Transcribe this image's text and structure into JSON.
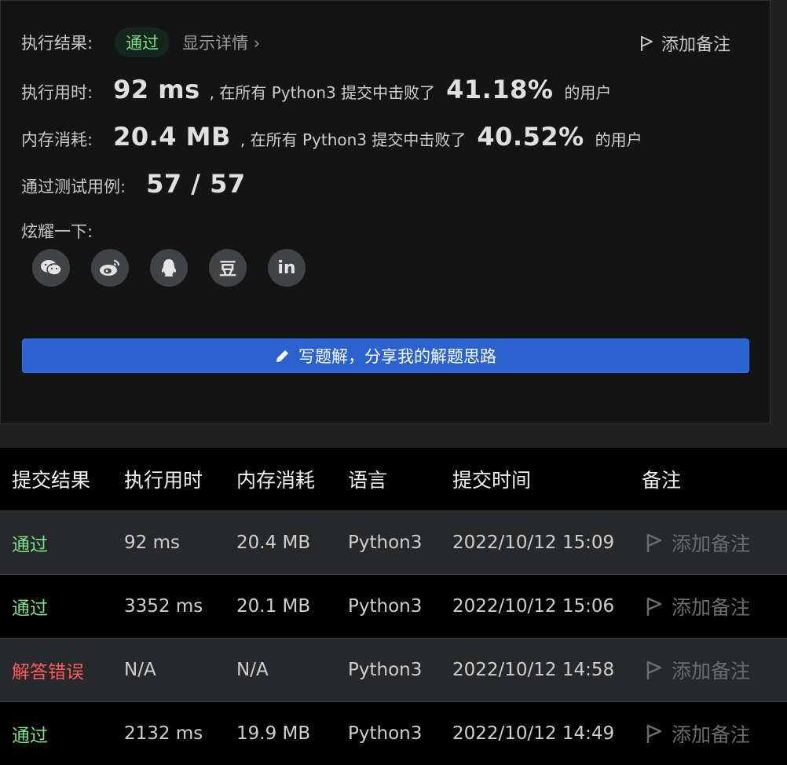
{
  "result": {
    "label": "执行结果:",
    "status": "通过",
    "details": "显示详情 ›",
    "add_note": "添加备注"
  },
  "runtime": {
    "label": "执行用时:",
    "value": "92 ms",
    "mid": ", 在所有 Python3 提交中击败了",
    "percent": "41.18%",
    "suffix": "的用户"
  },
  "memory": {
    "label": "内存消耗:",
    "value": "20.4 MB",
    "mid": ", 在所有 Python3 提交中击败了",
    "percent": "40.52%",
    "suffix": "的用户"
  },
  "tests": {
    "label": "通过测试用例:",
    "value": "57 / 57"
  },
  "share": {
    "label": "炫耀一下:",
    "icons": [
      "wechat-icon",
      "weibo-icon",
      "qq-icon",
      "douban-icon",
      "linkedin-icon"
    ],
    "douban_glyph": "豆",
    "linkedin_glyph": "in"
  },
  "write_button": "写题解，分享我的解题思路",
  "table": {
    "headers": [
      "提交结果",
      "执行用时",
      "内存消耗",
      "语言",
      "提交时间",
      "备注"
    ],
    "rows": [
      {
        "status": "通过",
        "time": "92 ms",
        "memory": "20.4 MB",
        "lang": "Python3",
        "submitted": "2022/10/12 15:09",
        "note": "添加备注"
      },
      {
        "status": "通过",
        "time": "3352 ms",
        "memory": "20.1 MB",
        "lang": "Python3",
        "submitted": "2022/10/12 15:06",
        "note": "添加备注"
      },
      {
        "status": "解答错误",
        "time": "N/A",
        "memory": "N/A",
        "lang": "Python3",
        "submitted": "2022/10/12 14:58",
        "note": "添加备注"
      },
      {
        "status": "通过",
        "time": "2132 ms",
        "memory": "19.9 MB",
        "lang": "Python3",
        "submitted": "2022/10/12 14:49",
        "note": "添加备注"
      }
    ]
  },
  "colors": {
    "pass": "#7ee08a",
    "fail": "#ff5b5b",
    "button": "#2a63cf"
  }
}
